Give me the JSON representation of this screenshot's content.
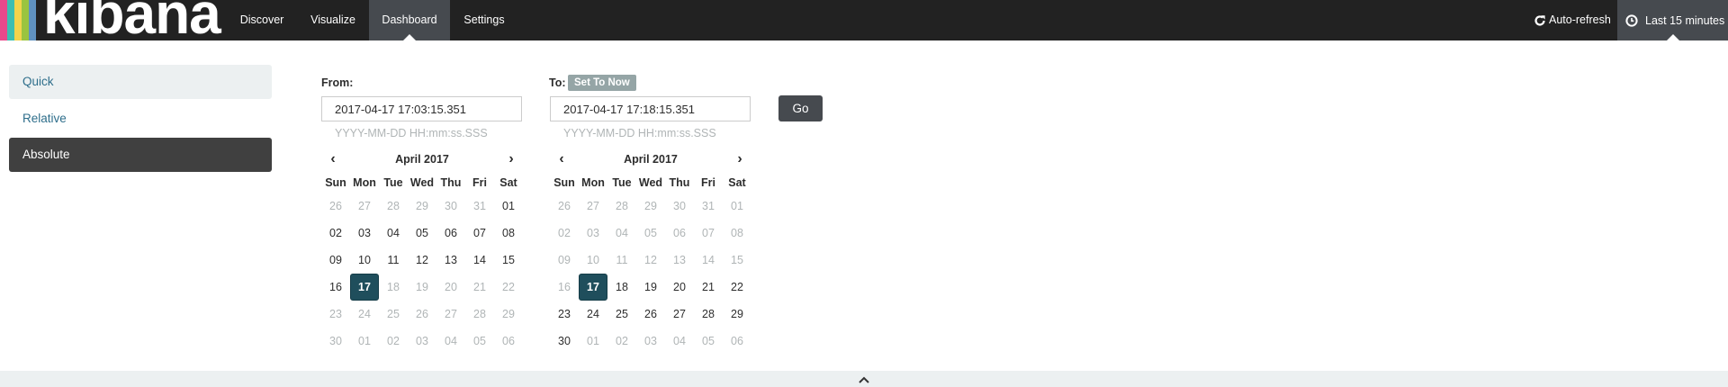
{
  "nav": {
    "logo_text": "kibana",
    "tabs": [
      "Discover",
      "Visualize",
      "Dashboard",
      "Settings"
    ],
    "active_tab": "Dashboard",
    "auto_refresh": "Auto-refresh",
    "time_label": "Last 15 minutes",
    "logo_colors": [
      "#e8488b",
      "#3cbeb1",
      "#f3d34b",
      "#9ac43f",
      "#6092c0"
    ]
  },
  "sidebar": {
    "modes": [
      "Quick",
      "Relative",
      "Absolute"
    ],
    "active": "Absolute"
  },
  "from": {
    "label": "From:",
    "value": "2017-04-17 17:03:15.351",
    "hint": "YYYY-MM-DD HH:mm:ss.SSS",
    "calendar": {
      "title": "April 2017",
      "weekdays": [
        "Sun",
        "Mon",
        "Tue",
        "Wed",
        "Thu",
        "Fri",
        "Sat"
      ],
      "weeks": [
        [
          "26",
          "27",
          "28",
          "29",
          "30",
          "31",
          "01"
        ],
        [
          "02",
          "03",
          "04",
          "05",
          "06",
          "07",
          "08"
        ],
        [
          "09",
          "10",
          "11",
          "12",
          "13",
          "14",
          "15"
        ],
        [
          "16",
          "17",
          "18",
          "19",
          "20",
          "21",
          "22"
        ],
        [
          "23",
          "24",
          "25",
          "26",
          "27",
          "28",
          "29"
        ],
        [
          "30",
          "01",
          "02",
          "03",
          "04",
          "05",
          "06"
        ]
      ],
      "selected": "17",
      "muted_before": [
        "26",
        "27",
        "28",
        "29",
        "30",
        "31"
      ],
      "muted_after_selected": true
    }
  },
  "to": {
    "label": "To:",
    "set_now": "Set To Now",
    "value": "2017-04-17 17:18:15.351",
    "hint": "YYYY-MM-DD HH:mm:ss.SSS",
    "calendar": {
      "title": "April 2017",
      "weekdays": [
        "Sun",
        "Mon",
        "Tue",
        "Wed",
        "Thu",
        "Fri",
        "Sat"
      ],
      "weeks": [
        [
          "26",
          "27",
          "28",
          "29",
          "30",
          "31",
          "01"
        ],
        [
          "02",
          "03",
          "04",
          "05",
          "06",
          "07",
          "08"
        ],
        [
          "09",
          "10",
          "11",
          "12",
          "13",
          "14",
          "15"
        ],
        [
          "16",
          "17",
          "18",
          "19",
          "20",
          "21",
          "22"
        ],
        [
          "23",
          "24",
          "25",
          "26",
          "27",
          "28",
          "29"
        ],
        [
          "30",
          "01",
          "02",
          "03",
          "04",
          "05",
          "06"
        ]
      ],
      "selected": "17"
    }
  },
  "go_label": "Go",
  "icons": {
    "prev": "chevron-left-icon",
    "next": "chevron-right-icon",
    "refresh": "refresh-icon",
    "clock": "clock-icon",
    "collapse": "chevron-up-icon"
  }
}
